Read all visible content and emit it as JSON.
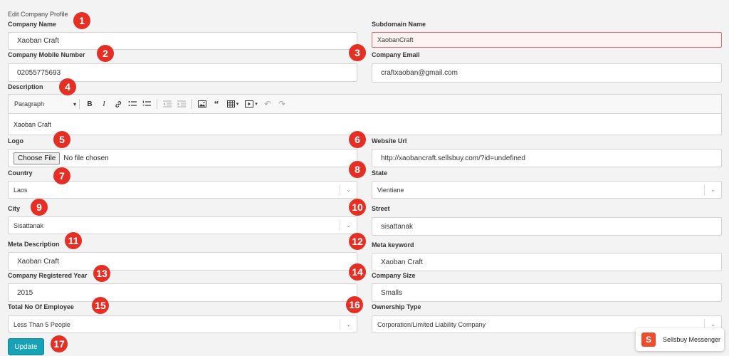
{
  "page": {
    "title": "Edit Company Profile"
  },
  "fields": {
    "company_name": {
      "label": "Company Name",
      "value": "Xaoban Craft"
    },
    "subdomain": {
      "label": "Subdomain Name",
      "value": "XaobanCraft"
    },
    "mobile": {
      "label": "Company Mobile Number",
      "value": "02055775693"
    },
    "email": {
      "label": "Company Email",
      "value": "craftxaoban@gmail.com"
    },
    "description": {
      "label": "Description",
      "value": "Xaoban Craft"
    },
    "logo": {
      "label": "Logo",
      "button": "Choose File",
      "status": "No file chosen"
    },
    "website": {
      "label": "Website Url",
      "value": "http://xaobancraft.sellsbuy.com/?id=undefined"
    },
    "country": {
      "label": "Country",
      "value": "Laos"
    },
    "state": {
      "label": "State",
      "value": "Vientiane"
    },
    "city": {
      "label": "City",
      "value": "Sisattanak"
    },
    "street": {
      "label": "Street",
      "value": "sisattanak"
    },
    "meta_description": {
      "label": "Meta Description",
      "value": "Xaoban Craft"
    },
    "meta_keyword": {
      "label": "Meta keyword",
      "value": "Xaoban Craft"
    },
    "registered_year": {
      "label": "Company Registered Year",
      "value": "2015"
    },
    "company_size": {
      "label": "Company Size",
      "value": "Smalls"
    },
    "employees": {
      "label": "Total No Of Employee",
      "value": "Less Than 5 People"
    },
    "ownership": {
      "label": "Ownership Type",
      "value": "Corporation/Limited Liability Company"
    }
  },
  "editor_toolbar": {
    "paragraph": "Paragraph",
    "icons": [
      "chevron-down-icon",
      "bold-icon",
      "italic-icon",
      "link-icon",
      "bulleted-list-icon",
      "numbered-list-icon",
      "outdent-icon",
      "indent-icon",
      "image-icon",
      "quote-icon",
      "table-icon",
      "media-icon",
      "undo-icon",
      "redo-icon"
    ]
  },
  "badges": [
    "1",
    "2",
    "3",
    "4",
    "5",
    "6",
    "7",
    "8",
    "9",
    "10",
    "11",
    "12",
    "13",
    "14",
    "15",
    "16",
    "17"
  ],
  "update_button": "Update",
  "messenger": {
    "label": "Sellsbuy Messenger",
    "icon_letter": "S"
  },
  "colors": {
    "badge": "#e52f24",
    "update": "#17a2b8",
    "error_border": "#e06a6a",
    "messenger_icon": "#ee4d2d"
  }
}
